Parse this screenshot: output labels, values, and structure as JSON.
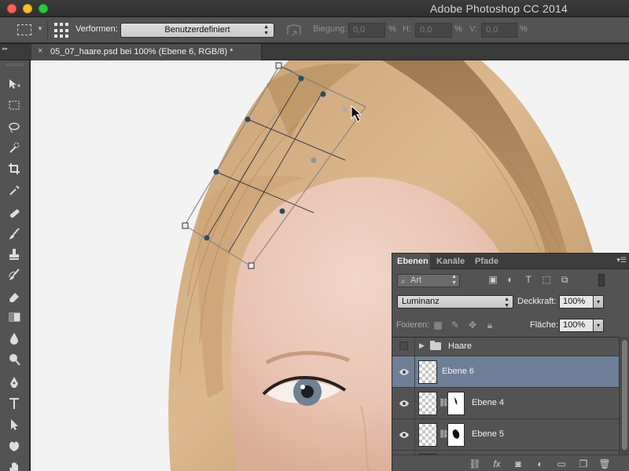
{
  "window": {
    "app_title": "Adobe Photoshop CC 2014"
  },
  "options_bar": {
    "warp_label": "Verformen:",
    "warp_value": "Benutzerdefiniert",
    "bend_label": "Biegung:",
    "bend_value": "0,0",
    "h_label": "H:",
    "h_value": "0,0",
    "v_label": "V:",
    "v_value": "0,0",
    "percent": "%"
  },
  "document": {
    "tab_title": "05_07_haare.psd bei 100% (Ebene 6, RGB/8) *",
    "close": "×"
  },
  "tools": [
    {
      "name": "move-tool-icon"
    },
    {
      "name": "marquee-tool-icon"
    },
    {
      "name": "lasso-tool-icon"
    },
    {
      "name": "quick-selection-tool-icon"
    },
    {
      "name": "crop-tool-icon"
    },
    {
      "name": "eyedropper-tool-icon"
    },
    {
      "name": "healing-brush-tool-icon"
    },
    {
      "name": "brush-tool-icon"
    },
    {
      "name": "clone-stamp-tool-icon"
    },
    {
      "name": "history-brush-tool-icon"
    },
    {
      "name": "eraser-tool-icon"
    },
    {
      "name": "gradient-tool-icon"
    },
    {
      "name": "blur-tool-icon"
    },
    {
      "name": "dodge-tool-icon"
    },
    {
      "name": "pen-tool-icon"
    },
    {
      "name": "type-tool-icon"
    },
    {
      "name": "path-selection-tool-icon"
    },
    {
      "name": "custom-shape-tool-icon"
    },
    {
      "name": "hand-tool-icon"
    }
  ],
  "layers_panel": {
    "tabs": [
      "Ebenen",
      "Kanäle",
      "Pfade"
    ],
    "filter_kind": "Art",
    "blend_mode": "Luminanz",
    "opacity_label": "Deckkraft:",
    "opacity_value": "100%",
    "lock_label": "Fixieren:",
    "fill_label": "Fläche:",
    "fill_value": "100%",
    "layers": [
      {
        "name": "Haare",
        "type": "group",
        "visible": false,
        "selected": false
      },
      {
        "name": "Ebene 6",
        "type": "pixel",
        "visible": true,
        "selected": true
      },
      {
        "name": "Ebene 4",
        "type": "masked",
        "visible": true,
        "selected": false
      },
      {
        "name": "Ebene 5",
        "type": "masked",
        "visible": true,
        "selected": false
      }
    ]
  },
  "colors": {
    "selected_layer": "#6e7e96",
    "panel_bg": "#535353",
    "app_bg": "#1e1e1e"
  }
}
